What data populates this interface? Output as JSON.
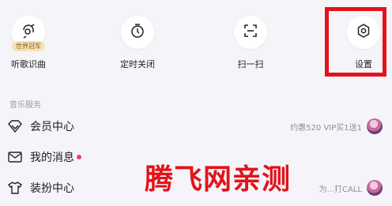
{
  "shortcuts": [
    {
      "label": "听歌识曲",
      "icon": "music-recognition-icon",
      "badge": "世界冠军"
    },
    {
      "label": "定时关闭",
      "icon": "timer-icon"
    },
    {
      "label": "扫一扫",
      "icon": "scan-icon"
    },
    {
      "label": "设置",
      "icon": "gear-icon"
    }
  ],
  "section": {
    "title": "音乐服务"
  },
  "menu": [
    {
      "label": "会员中心",
      "icon": "diamond-icon",
      "promo": "约惠520 VIP买1送1"
    },
    {
      "label": "我的消息",
      "icon": "mail-icon"
    },
    {
      "label": "装扮中心",
      "icon": "tshirt-icon",
      "promo": "为...打CALL"
    }
  ],
  "watermark": {
    "text": "腾飞网亲测"
  },
  "colors": {
    "accent": "#e3131b",
    "dot": "#f0406b",
    "background": "#f5f5f9"
  }
}
